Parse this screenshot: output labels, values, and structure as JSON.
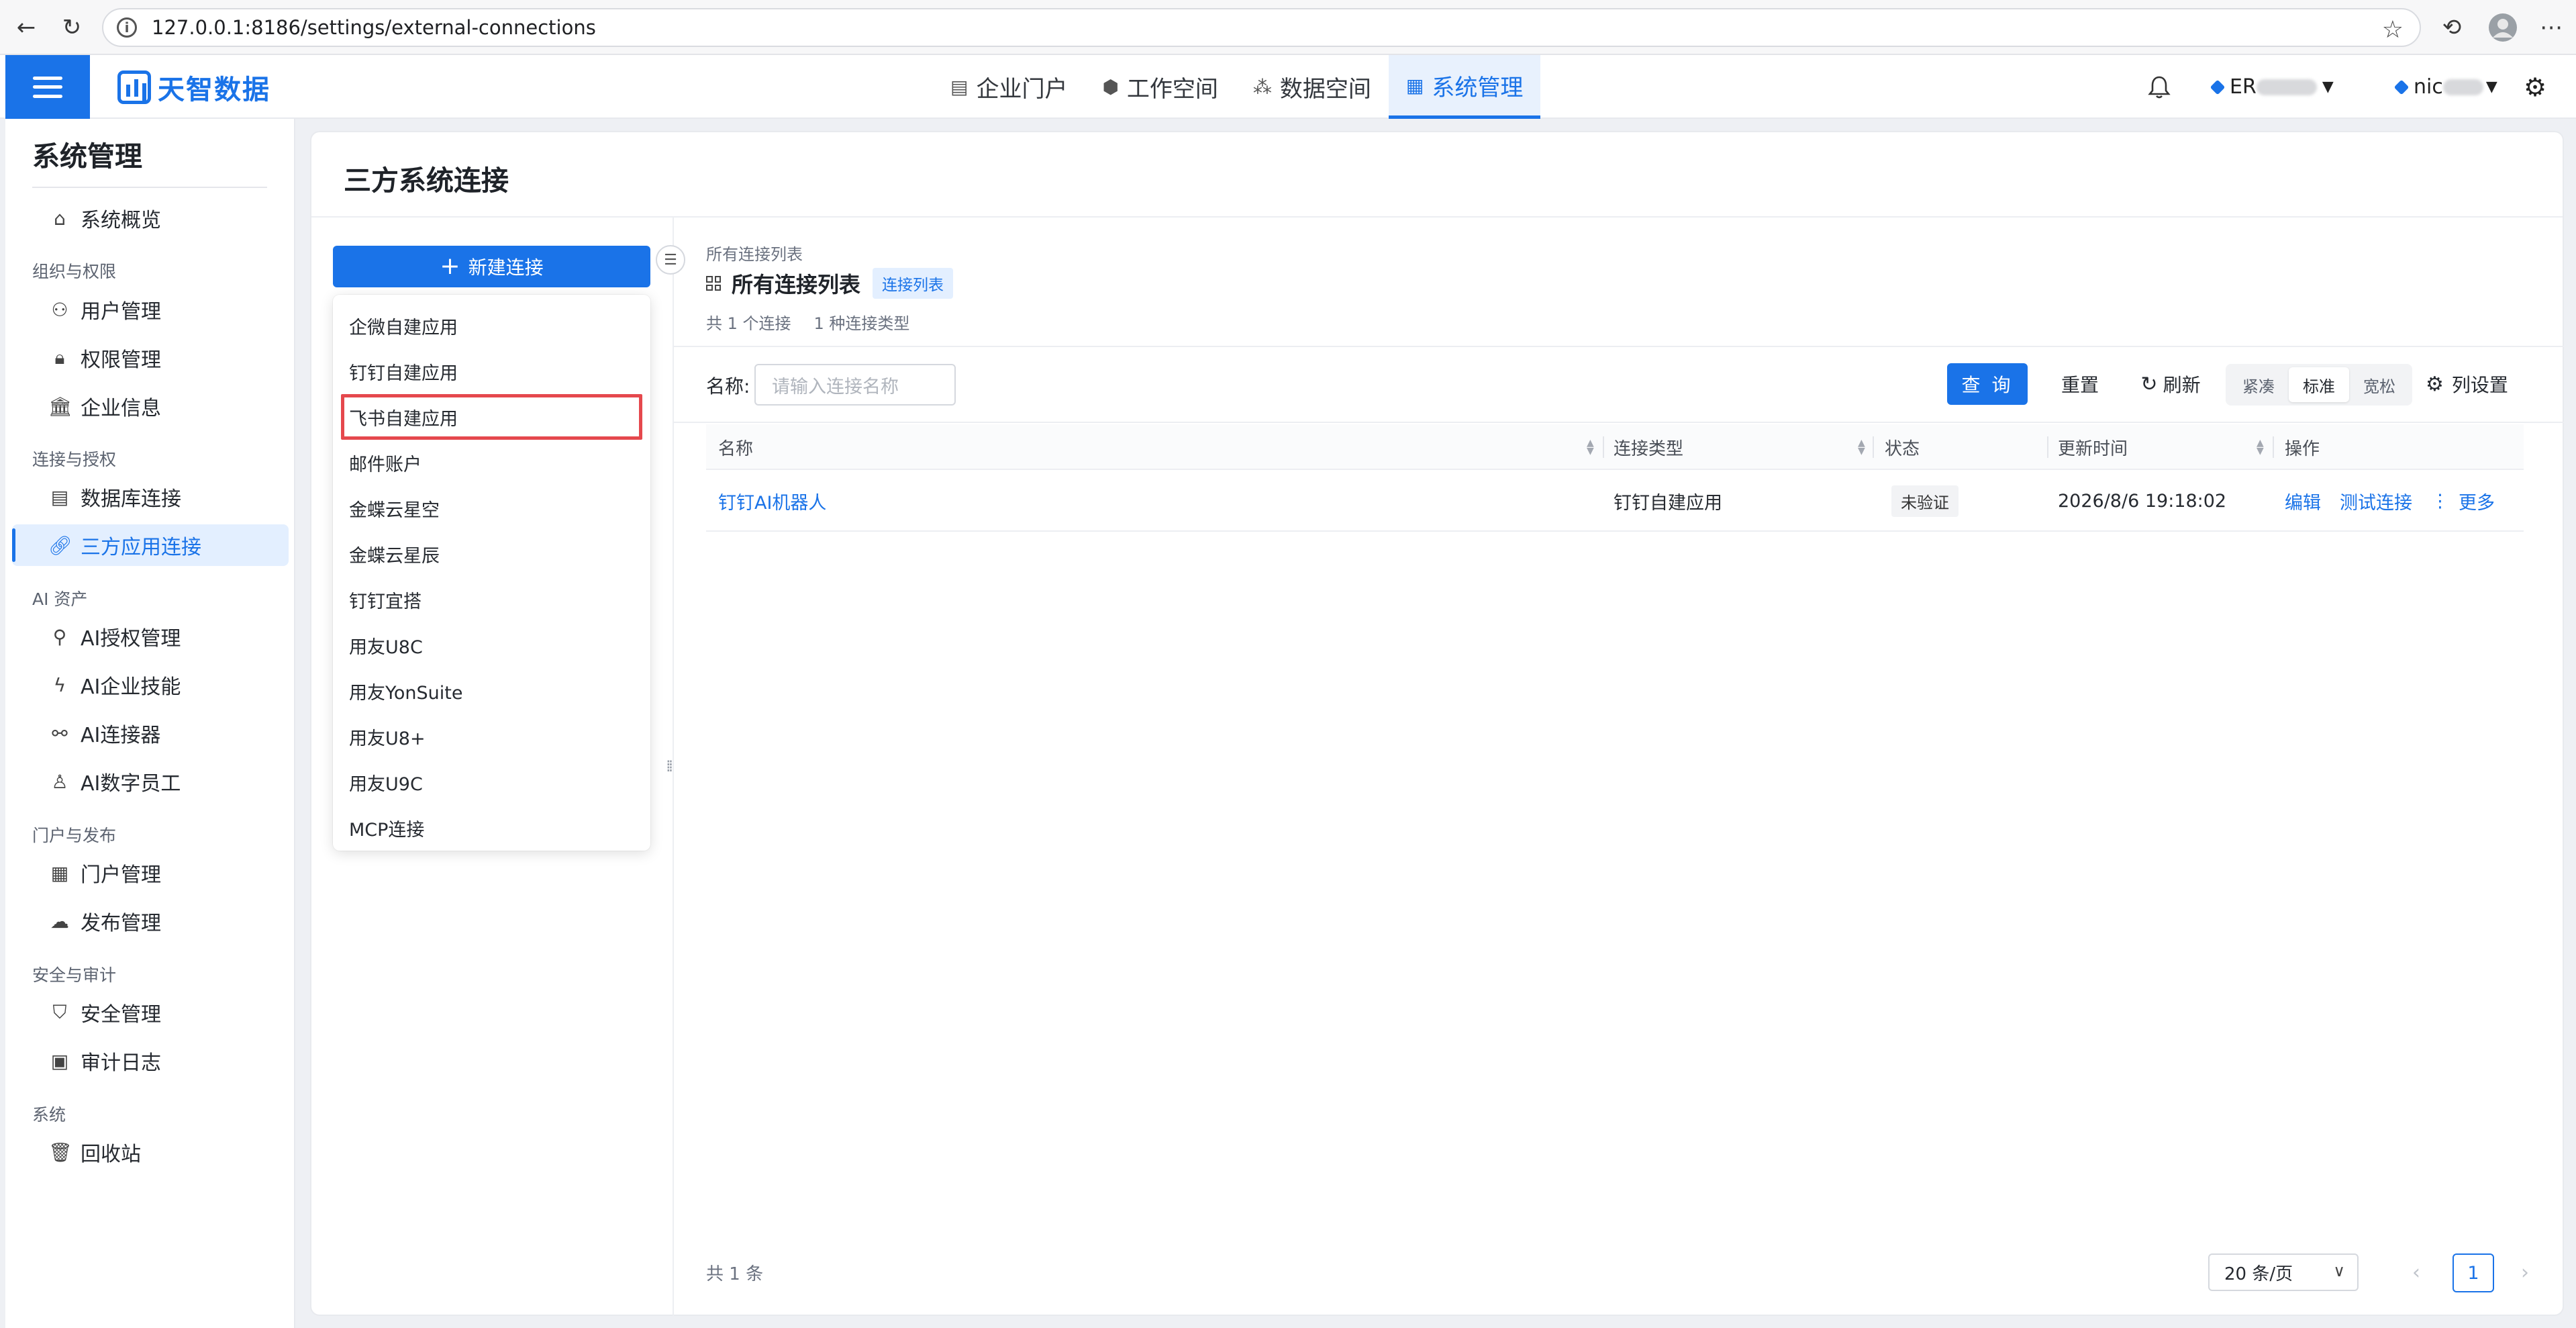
{
  "browser": {
    "url": "127.0.0.1:8186/settings/external-connections"
  },
  "header": {
    "logo_text": "天智数据",
    "nav": [
      {
        "label": "企业门户",
        "icon": "portal-icon"
      },
      {
        "label": "工作空间",
        "icon": "cube-icon"
      },
      {
        "label": "数据空间",
        "icon": "nodes-icon"
      },
      {
        "label": "系统管理",
        "icon": "grid-icon",
        "active": true
      }
    ],
    "org_prefix": "ER",
    "user_prefix": "nic"
  },
  "sidebar": {
    "title": "系统管理",
    "overview": "系统概览",
    "groups": [
      {
        "label": "组织与权限",
        "items": [
          "用户管理",
          "权限管理",
          "企业信息"
        ]
      },
      {
        "label": "连接与授权",
        "items": [
          "数据库连接",
          "三方应用连接"
        ]
      },
      {
        "label": "AI 资产",
        "items": [
          "AI授权管理",
          "AI企业技能",
          "AI连接器",
          "AI数字员工"
        ]
      },
      {
        "label": "门户与发布",
        "items": [
          "门户管理",
          "发布管理"
        ]
      },
      {
        "label": "安全与审计",
        "items": [
          "安全管理",
          "审计日志"
        ]
      },
      {
        "label": "系统",
        "items": [
          "回收站"
        ]
      }
    ]
  },
  "main": {
    "page_title": "三方系统连接",
    "new_button": "新建连接",
    "dropdown_items": [
      "企微自建应用",
      "钉钉自建应用",
      "飞书自建应用",
      "邮件账户",
      "金蝶云星空",
      "金蝶云星辰",
      "钉钉宜搭",
      "用友U8C",
      "用友YonSuite",
      "用友U8+",
      "用友U9C",
      "MCP连接"
    ],
    "crumb": "所有连接列表",
    "list_title": "所有连接列表",
    "list_tag": "连接列表",
    "stats": [
      "共 1 个连接",
      "1 种连接类型"
    ],
    "filter": {
      "label": "名称:",
      "placeholder": "请输入连接名称",
      "query": "查 询",
      "reset": "重置",
      "refresh": "刷新",
      "density": [
        "紧凑",
        "标准",
        "宽松"
      ],
      "columns": "列设置"
    },
    "table": {
      "headers": [
        "名称",
        "连接类型",
        "状态",
        "更新时间",
        "操作"
      ],
      "rows": [
        {
          "name": "钉钉AI机器人",
          "type": "钉钉自建应用",
          "status": "未验证",
          "updated": "2026/8/6 19:18:02"
        }
      ],
      "actions": [
        "编辑",
        "测试连接",
        "更多"
      ]
    },
    "pagination": {
      "total": "共 1 条",
      "page_size": "20 条/页",
      "current": "1"
    }
  }
}
